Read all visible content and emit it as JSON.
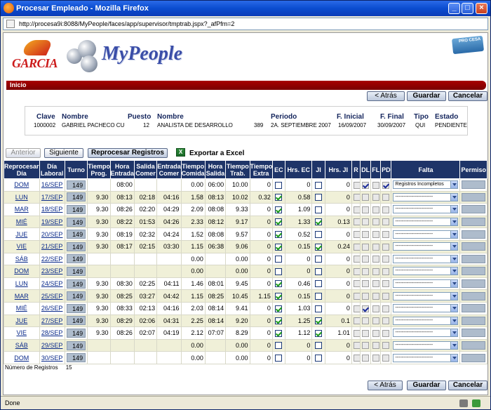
{
  "window": {
    "title": "Procesar Empleado - Mozilla Firefox",
    "url": "http://procesa9i:8088/MyPeople/faces/app/supervisor/tmptrab.jspx?_afPfm=2"
  },
  "brand": {
    "company": "GARCIA",
    "app": "MyPeople",
    "badge": "PRO CESA"
  },
  "nav": {
    "home": "Inicio"
  },
  "buttons": {
    "back": "< Atrás",
    "save": "Guardar",
    "cancel": "Cancelar",
    "prev": "Anterior",
    "next": "Siguiente",
    "reprocess": "Reprocesar Registros",
    "export": "Exportar a Excel"
  },
  "employee": {
    "clave_h": "Clave",
    "clave": "1000002",
    "nombre_h": "Nombre",
    "nombre": "GABRIEL PACHECO CU",
    "puesto_h": "Puesto",
    "puesto": "12",
    "nombre2_h": "Nombre",
    "nombre2": "ANALISTA DE DESARROLLO",
    "extra": "389",
    "periodo_h": "Periodo",
    "periodo": "2A. SEPTIEMBRE 2007",
    "finicial_h": "F. Inicial",
    "finicial": "16/09/2007",
    "ffinal_h": "F. Final",
    "ffinal": "30/09/2007",
    "tipo_h": "Tipo",
    "tipo": "QUI",
    "estado_h": "Estado",
    "estado": "PENDIENTE"
  },
  "columns": [
    "Reprocesar Día",
    "Día Laboral",
    "Turno",
    "Tiempo Prog.",
    "Hora Entrada",
    "Salida Comer",
    "Entrada Comer",
    "Tiempo Comida",
    "Hora Salida",
    "Tiempo Trab.",
    "Tiempo Extra",
    "EC",
    "Hrs. EC",
    "JI",
    "Hrs. JI",
    "R",
    "DL",
    "FL",
    "PD",
    "Falta",
    "Permiso"
  ],
  "rows": [
    {
      "dia": "DOM",
      "fecha": "16/SEP",
      "turno": "149",
      "prog": "",
      "entrada": "08:00",
      "salcomer": "",
      "entcomer": "",
      "comida": "0.00",
      "salida": "06:00",
      "trab": "10.00",
      "extra": "0",
      "ec": false,
      "hrsec": "0",
      "ji": false,
      "hrsji": "0",
      "r": false,
      "dl": true,
      "fl": false,
      "pd": true,
      "falta": "Registros Incompletos"
    },
    {
      "dia": "LUN",
      "fecha": "17/SEP",
      "turno": "149",
      "prog": "9.30",
      "entrada": "08:13",
      "salcomer": "02:18",
      "entcomer": "04:16",
      "comida": "1.58",
      "salida": "08:13",
      "trab": "10.02",
      "extra": "0.32",
      "ec": true,
      "hrsec": "0.58",
      "ji": false,
      "hrsji": "0",
      "r": false,
      "dl": false,
      "fl": false,
      "pd": false,
      "falta": "-----------------------"
    },
    {
      "dia": "MAR",
      "fecha": "18/SEP",
      "turno": "149",
      "prog": "9.30",
      "entrada": "08:26",
      "salcomer": "02:20",
      "entcomer": "04:29",
      "comida": "2.09",
      "salida": "08:08",
      "trab": "9.33",
      "extra": "0",
      "ec": true,
      "hrsec": "1.09",
      "ji": false,
      "hrsji": "0",
      "r": false,
      "dl": false,
      "fl": false,
      "pd": false,
      "falta": "-----------------------"
    },
    {
      "dia": "MIÉ",
      "fecha": "19/SEP",
      "turno": "149",
      "prog": "9.30",
      "entrada": "08:22",
      "salcomer": "01:53",
      "entcomer": "04:26",
      "comida": "2.33",
      "salida": "08:12",
      "trab": "9.17",
      "extra": "0",
      "ec": true,
      "hrsec": "1.33",
      "ji": true,
      "hrsji": "0.13",
      "r": false,
      "dl": false,
      "fl": false,
      "pd": false,
      "falta": "-----------------------"
    },
    {
      "dia": "JUE",
      "fecha": "20/SEP",
      "turno": "149",
      "prog": "9.30",
      "entrada": "08:19",
      "salcomer": "02:32",
      "entcomer": "04:24",
      "comida": "1.52",
      "salida": "08:08",
      "trab": "9.57",
      "extra": "0",
      "ec": true,
      "hrsec": "0.52",
      "ji": false,
      "hrsji": "0",
      "r": false,
      "dl": false,
      "fl": false,
      "pd": false,
      "falta": "-----------------------"
    },
    {
      "dia": "VIE",
      "fecha": "21/SEP",
      "turno": "149",
      "prog": "9.30",
      "entrada": "08:17",
      "salcomer": "02:15",
      "entcomer": "03:30",
      "comida": "1.15",
      "salida": "06:38",
      "trab": "9.06",
      "extra": "0",
      "ec": true,
      "hrsec": "0.15",
      "ji": true,
      "hrsji": "0.24",
      "r": false,
      "dl": false,
      "fl": false,
      "pd": false,
      "falta": "-----------------------"
    },
    {
      "dia": "SÁB",
      "fecha": "22/SEP",
      "turno": "149",
      "prog": "",
      "entrada": "",
      "salcomer": "",
      "entcomer": "",
      "comida": "0.00",
      "salida": "",
      "trab": "0.00",
      "extra": "0",
      "ec": false,
      "hrsec": "0",
      "ji": false,
      "hrsji": "0",
      "r": false,
      "dl": false,
      "fl": false,
      "pd": false,
      "falta": "-----------------------"
    },
    {
      "dia": "DOM",
      "fecha": "23/SEP",
      "turno": "149",
      "prog": "",
      "entrada": "",
      "salcomer": "",
      "entcomer": "",
      "comida": "0.00",
      "salida": "",
      "trab": "0.00",
      "extra": "0",
      "ec": false,
      "hrsec": "0",
      "ji": false,
      "hrsji": "0",
      "r": false,
      "dl": false,
      "fl": false,
      "pd": false,
      "falta": "-----------------------"
    },
    {
      "dia": "LUN",
      "fecha": "24/SEP",
      "turno": "149",
      "prog": "9.30",
      "entrada": "08:30",
      "salcomer": "02:25",
      "entcomer": "04:11",
      "comida": "1.46",
      "salida": "08:01",
      "trab": "9.45",
      "extra": "0",
      "ec": true,
      "hrsec": "0.46",
      "ji": false,
      "hrsji": "0",
      "r": false,
      "dl": false,
      "fl": false,
      "pd": false,
      "falta": "-----------------------"
    },
    {
      "dia": "MAR",
      "fecha": "25/SEP",
      "turno": "149",
      "prog": "9.30",
      "entrada": "08:25",
      "salcomer": "03:27",
      "entcomer": "04:42",
      "comida": "1.15",
      "salida": "08:25",
      "trab": "10.45",
      "extra": "1.15",
      "ec": true,
      "hrsec": "0.15",
      "ji": false,
      "hrsji": "0",
      "r": false,
      "dl": false,
      "fl": false,
      "pd": false,
      "falta": "-----------------------"
    },
    {
      "dia": "MIÉ",
      "fecha": "26/SEP",
      "turno": "149",
      "prog": "9.30",
      "entrada": "08:33",
      "salcomer": "02:13",
      "entcomer": "04:16",
      "comida": "2.03",
      "salida": "08:14",
      "trab": "9.41",
      "extra": "0",
      "ec": true,
      "hrsec": "1.03",
      "ji": false,
      "hrsji": "0",
      "r": false,
      "dl": true,
      "fl": false,
      "pd": false,
      "falta": "-----------------------"
    },
    {
      "dia": "JUE",
      "fecha": "27/SEP",
      "turno": "149",
      "prog": "9.30",
      "entrada": "08:29",
      "salcomer": "02:06",
      "entcomer": "04:31",
      "comida": "2.25",
      "salida": "08:14",
      "trab": "9.20",
      "extra": "0",
      "ec": true,
      "hrsec": "1.25",
      "ji": true,
      "hrsji": "0.1",
      "r": false,
      "dl": false,
      "fl": false,
      "pd": false,
      "falta": "-----------------------"
    },
    {
      "dia": "VIE",
      "fecha": "28/SEP",
      "turno": "149",
      "prog": "9.30",
      "entrada": "08:26",
      "salcomer": "02:07",
      "entcomer": "04:19",
      "comida": "2.12",
      "salida": "07:07",
      "trab": "8.29",
      "extra": "0",
      "ec": true,
      "hrsec": "1.12",
      "ji": true,
      "hrsji": "1.01",
      "r": false,
      "dl": false,
      "fl": false,
      "pd": false,
      "falta": "-----------------------"
    },
    {
      "dia": "SÁB",
      "fecha": "29/SEP",
      "turno": "149",
      "prog": "",
      "entrada": "",
      "salcomer": "",
      "entcomer": "",
      "comida": "0.00",
      "salida": "",
      "trab": "0.00",
      "extra": "0",
      "ec": false,
      "hrsec": "0",
      "ji": false,
      "hrsji": "0",
      "r": false,
      "dl": false,
      "fl": false,
      "pd": false,
      "falta": "-----------------------"
    },
    {
      "dia": "DOM",
      "fecha": "30/SEP",
      "turno": "149",
      "prog": "",
      "entrada": "",
      "salcomer": "",
      "entcomer": "",
      "comida": "0.00",
      "salida": "",
      "trab": "0.00",
      "extra": "0",
      "ec": false,
      "hrsec": "0",
      "ji": false,
      "hrsji": "0",
      "r": false,
      "dl": false,
      "fl": false,
      "pd": false,
      "falta": "-----------------------"
    }
  ],
  "footer": {
    "count_label": "Número de Registros",
    "count": "15"
  },
  "status": {
    "text": "Done"
  },
  "colors": {
    "header_blue": "#1e3468",
    "brand_red": "#8a0000",
    "row_alt": "#f0f0d8"
  }
}
